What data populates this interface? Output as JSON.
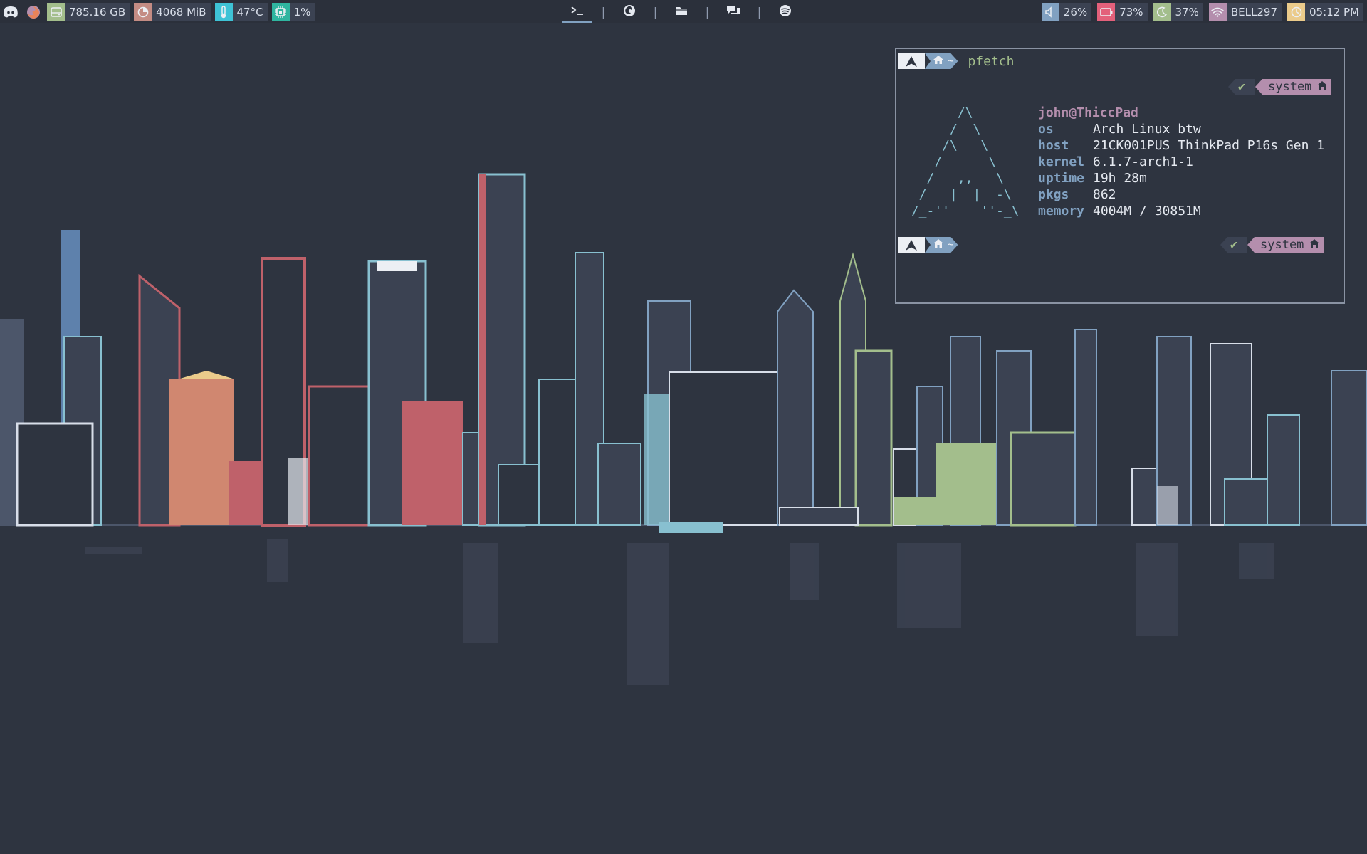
{
  "topbar": {
    "apps": [
      {
        "name": "discord-icon",
        "color": "#e5e9f0"
      },
      {
        "name": "firefox-icon",
        "color": "#b48ead"
      }
    ],
    "modules_left": [
      {
        "icon": "disk-icon",
        "text": "785.16 GB",
        "color": "#a3be8c"
      },
      {
        "icon": "memory-icon",
        "text": "4068 MiB",
        "color": "#c48c84"
      },
      {
        "icon": "thermometer-icon",
        "text": "47°C",
        "color": "#3ec3d6"
      },
      {
        "icon": "cpu-icon",
        "text": "1%",
        "color": "#2fb5a0"
      }
    ],
    "workspaces": [
      {
        "icon": "terminal-icon",
        "active": true
      },
      {
        "icon": "firefox-icon",
        "active": false
      },
      {
        "icon": "folder-icon",
        "active": false
      },
      {
        "icon": "chat-icon",
        "active": false
      },
      {
        "icon": "spotify-icon",
        "active": false
      }
    ],
    "workspace_separator": "|",
    "modules_right": [
      {
        "icon": "volume-icon",
        "text": "26%",
        "color": "#81a1c1"
      },
      {
        "icon": "battery-icon",
        "text": "73%",
        "color": "#e3607b"
      },
      {
        "icon": "brightness-icon",
        "text": "37%",
        "color": "#a3be8c"
      },
      {
        "icon": "wifi-icon",
        "text": "BELL297",
        "color": "#b48ead"
      },
      {
        "icon": "clock-icon",
        "text": "05:12 PM",
        "color": "#ebcb8b"
      }
    ]
  },
  "terminal": {
    "prompt1": {
      "home": "~",
      "command": "pfetch"
    },
    "rprompt1": {
      "status": "✔",
      "label": "system"
    },
    "ascii_logo": "       /\\\n      /  \\\n     /\\   \\\n    /      \\\n   /   ,,   \\\n  /   |  |  -\\\n /_-''    ''-_\\",
    "user_host": "john@ThiccPad",
    "info": [
      {
        "key": "os",
        "value": "Arch Linux btw"
      },
      {
        "key": "host",
        "value": "21CK001PUS ThinkPad P16s Gen 1"
      },
      {
        "key": "kernel",
        "value": "6.1.7-arch1-1"
      },
      {
        "key": "uptime",
        "value": "19h 28m"
      },
      {
        "key": "pkgs",
        "value": "862"
      },
      {
        "key": "memory",
        "value": "4004M / 30851M"
      }
    ],
    "prompt2": {
      "home": "~"
    },
    "rprompt2": {
      "status": "✔",
      "label": "system"
    }
  }
}
